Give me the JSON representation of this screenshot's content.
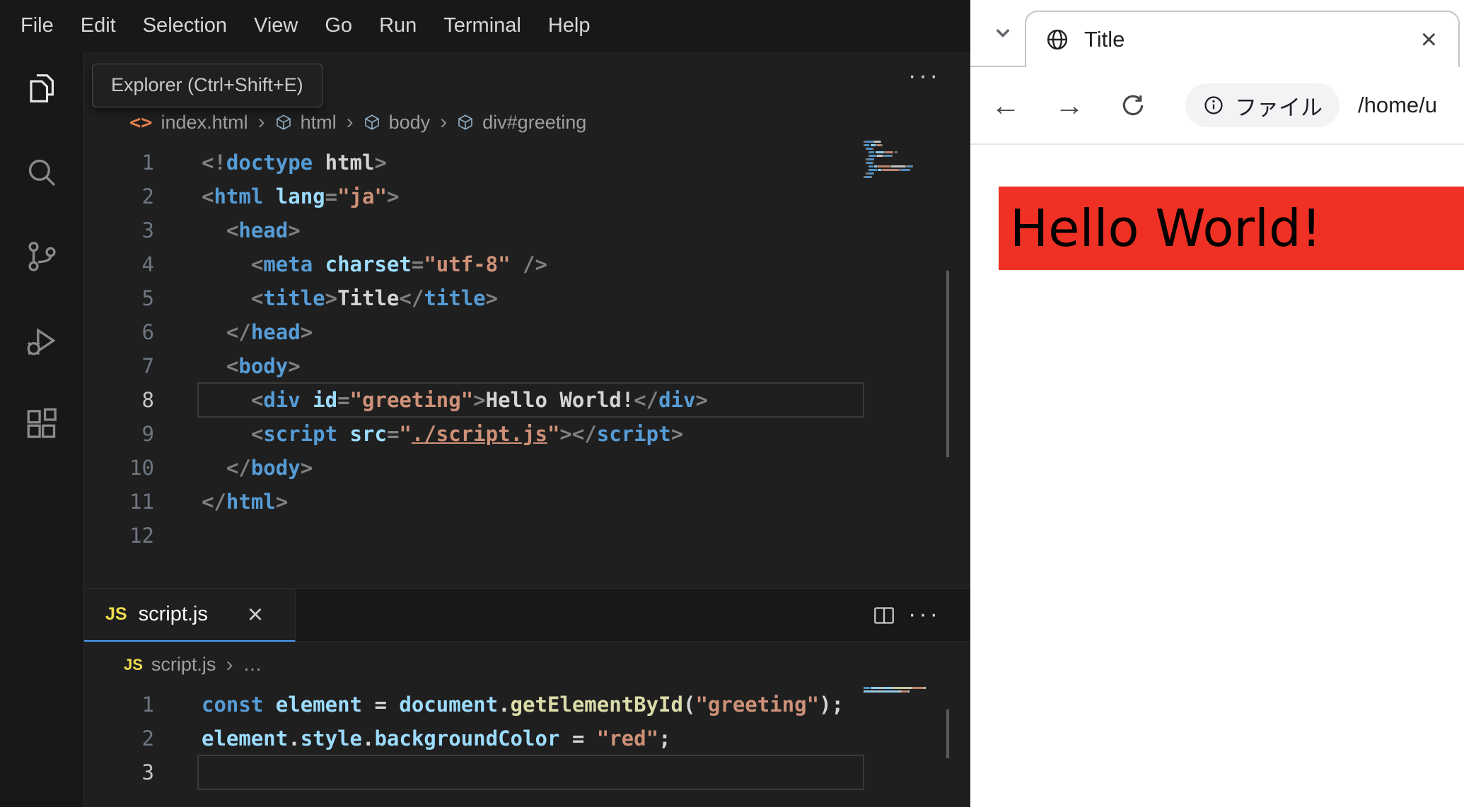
{
  "colors": {
    "token": {
      "p": "#808080",
      "tag": "#569cd6",
      "attr": "#9cdcfe",
      "str": "#ce9178",
      "fn": "#dcdcaa",
      "kw": "#569cd6",
      "var": "#9cdcfe",
      "fg": "#d4d4d4"
    },
    "greeting_bg": "#ee3124",
    "tab_active_border": "#4d9df6",
    "js_badge": "#f0dc4e",
    "html_badge_color": "#e8824f"
  },
  "glyphs": {
    "crumb_sep": "›",
    "more": "···",
    "html_badge": "<>",
    "back": "←",
    "forward": "→",
    "close": "×",
    "ellipsis": "…"
  },
  "vscode": {
    "menu": {
      "items": [
        "File",
        "Edit",
        "Selection",
        "View",
        "Go",
        "Run",
        "Terminal",
        "Help"
      ]
    },
    "activity_bar": {
      "items": [
        {
          "name": "explorer"
        },
        {
          "name": "search"
        },
        {
          "name": "source-control"
        },
        {
          "name": "run-and-debug"
        },
        {
          "name": "extensions"
        }
      ]
    },
    "tooltip": "Explorer (Ctrl+Shift+E)",
    "html_editor": {
      "breadcrumb": {
        "file": "index.html",
        "items": [
          "html",
          "body",
          "div#greeting"
        ]
      },
      "active_line": 8,
      "lines": [
        [
          [
            "p",
            "<!"
          ],
          [
            "tag",
            "doctype"
          ],
          [
            "fg",
            " html"
          ],
          [
            "p",
            ">"
          ]
        ],
        [
          [
            "p",
            "<"
          ],
          [
            "tag",
            "html"
          ],
          [
            "fg",
            " "
          ],
          [
            "attr",
            "lang"
          ],
          [
            "p",
            "="
          ],
          [
            "str",
            "\"ja\""
          ],
          [
            "p",
            ">"
          ]
        ],
        [
          [
            "fg",
            "  "
          ],
          [
            "p",
            "<"
          ],
          [
            "tag",
            "head"
          ],
          [
            "p",
            ">"
          ]
        ],
        [
          [
            "fg",
            "    "
          ],
          [
            "p",
            "<"
          ],
          [
            "tag",
            "meta"
          ],
          [
            "fg",
            " "
          ],
          [
            "attr",
            "charset"
          ],
          [
            "p",
            "="
          ],
          [
            "str",
            "\"utf-8\""
          ],
          [
            "fg",
            " "
          ],
          [
            "p",
            "/>"
          ]
        ],
        [
          [
            "fg",
            "    "
          ],
          [
            "p",
            "<"
          ],
          [
            "tag",
            "title"
          ],
          [
            "p",
            ">"
          ],
          [
            "fg",
            "Title"
          ],
          [
            "p",
            "</"
          ],
          [
            "tag",
            "title"
          ],
          [
            "p",
            ">"
          ]
        ],
        [
          [
            "fg",
            "  "
          ],
          [
            "p",
            "</"
          ],
          [
            "tag",
            "head"
          ],
          [
            "p",
            ">"
          ]
        ],
        [
          [
            "fg",
            "  "
          ],
          [
            "p",
            "<"
          ],
          [
            "tag",
            "body"
          ],
          [
            "p",
            ">"
          ]
        ],
        [
          [
            "fg",
            "    "
          ],
          [
            "p",
            "<"
          ],
          [
            "tag",
            "div"
          ],
          [
            "fg",
            " "
          ],
          [
            "attr",
            "id"
          ],
          [
            "p",
            "="
          ],
          [
            "str",
            "\"greeting\""
          ],
          [
            "p",
            ">"
          ],
          [
            "fg",
            "Hello World!"
          ],
          [
            "p",
            "</"
          ],
          [
            "tag",
            "div"
          ],
          [
            "p",
            ">"
          ]
        ],
        [
          [
            "fg",
            "    "
          ],
          [
            "p",
            "<"
          ],
          [
            "tag",
            "script"
          ],
          [
            "fg",
            " "
          ],
          [
            "attr",
            "src"
          ],
          [
            "p",
            "="
          ],
          [
            "str",
            "\""
          ],
          [
            "str u",
            "./script.js"
          ],
          [
            "str",
            "\""
          ],
          [
            "p",
            "></"
          ],
          [
            "tag",
            "script"
          ],
          [
            "p",
            ">"
          ]
        ],
        [
          [
            "fg",
            "  "
          ],
          [
            "p",
            "</"
          ],
          [
            "tag",
            "body"
          ],
          [
            "p",
            ">"
          ]
        ],
        [
          [
            "p",
            "</"
          ],
          [
            "tag",
            "html"
          ],
          [
            "p",
            ">"
          ]
        ],
        []
      ]
    },
    "js_editor": {
      "tab_badge": "JS",
      "tab_label": "script.js",
      "breadcrumb": {
        "file": "script.js"
      },
      "active_line": 3,
      "lines": [
        [
          [
            "kw",
            "const"
          ],
          [
            "fg",
            " "
          ],
          [
            "var",
            "element"
          ],
          [
            "fg",
            " = "
          ],
          [
            "var",
            "document"
          ],
          [
            "fg",
            "."
          ],
          [
            "fn",
            "getElementById"
          ],
          [
            "fg",
            "("
          ],
          [
            "str",
            "\"greeting\""
          ],
          [
            "fg",
            ");"
          ]
        ],
        [
          [
            "var",
            "element"
          ],
          [
            "fg",
            "."
          ],
          [
            "var",
            "style"
          ],
          [
            "fg",
            "."
          ],
          [
            "var",
            "backgroundColor"
          ],
          [
            "fg",
            " = "
          ],
          [
            "str",
            "\"red\""
          ],
          [
            "fg",
            ";"
          ]
        ],
        []
      ]
    }
  },
  "browser": {
    "tab": {
      "title": "Title"
    },
    "toolbar": {
      "scheme_chip": "ファイル",
      "url": "/home/u"
    },
    "page": {
      "greeting": "Hello World!"
    }
  }
}
